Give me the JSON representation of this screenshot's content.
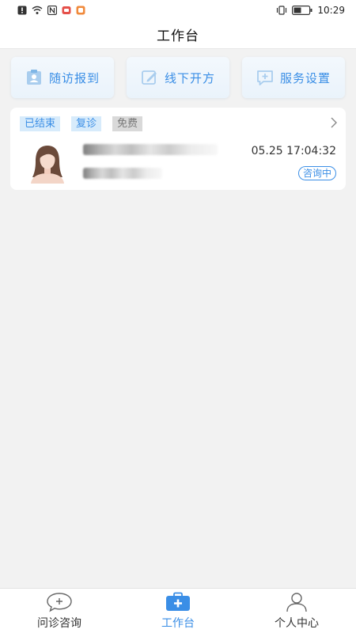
{
  "status_bar": {
    "time": "10:29",
    "icons": [
      "alert-icon",
      "wifi-icon",
      "nfc-icon",
      "notification-icon",
      "app-icon",
      "vibrate-icon",
      "battery-icon"
    ]
  },
  "header": {
    "title": "工作台"
  },
  "actions": [
    {
      "label": "随访报到",
      "icon": "follow-up-icon"
    },
    {
      "label": "线下开方",
      "icon": "prescription-icon"
    },
    {
      "label": "服务设置",
      "icon": "service-settings-icon"
    }
  ],
  "record": {
    "status_tag": "已结束",
    "type_tag": "复诊",
    "fee_tag": "免费",
    "datetime": "05.25 17:04:32",
    "state": "咨询中"
  },
  "bottom_nav": {
    "items": [
      {
        "label": "问诊咨询",
        "icon": "chat-plus-icon",
        "active": false
      },
      {
        "label": "工作台",
        "icon": "medical-kit-icon",
        "active": true
      },
      {
        "label": "个人中心",
        "icon": "person-icon",
        "active": false
      }
    ]
  },
  "colors": {
    "accent": "#3a8ee6",
    "background": "#f2f2f2",
    "tag_bg": "#d7ebfb",
    "fee_tag_bg": "#d9d9d9"
  }
}
